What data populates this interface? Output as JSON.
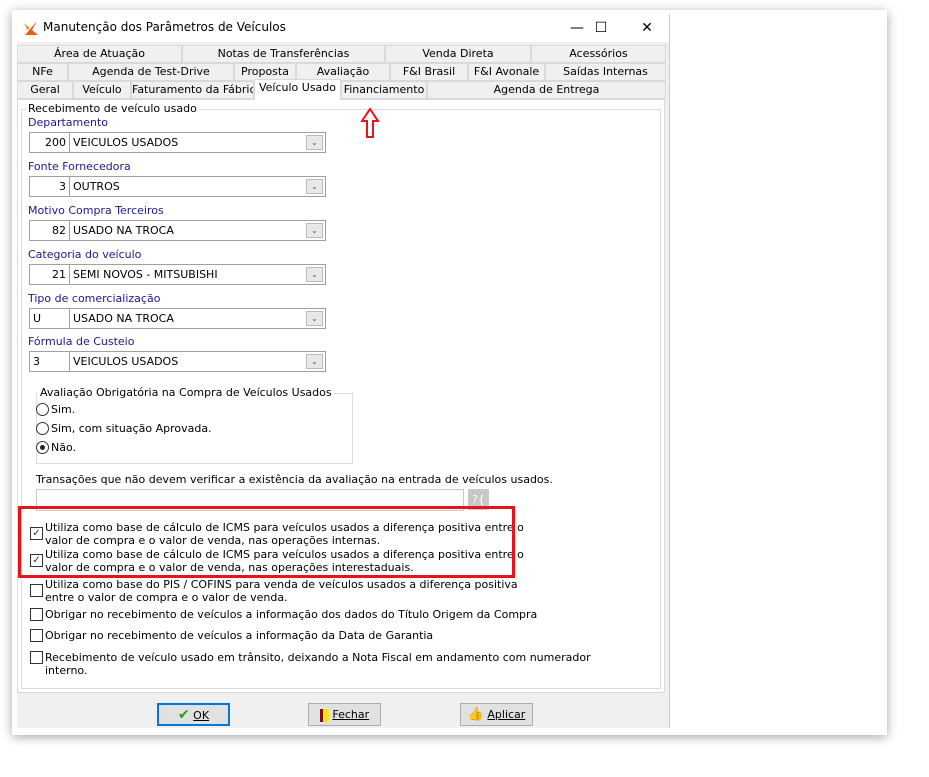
{
  "window": {
    "title": "Manutenção dos Parâmetros de Veículos",
    "minimize": "—",
    "maximize": "☐",
    "close": "✕"
  },
  "tabs": {
    "row1": [
      "Área de Atuação",
      "Notas de Transferências",
      "Venda Direta",
      "Acessórios"
    ],
    "row2": [
      "NFe",
      "Agenda de Test-Drive",
      "Proposta",
      "Avaliação",
      "F&I Brasil",
      "F&I Avonale",
      "Saídas Internas"
    ],
    "row3": [
      "Geral",
      "Veículo",
      "Faturamento da Fábrica",
      "Veículo Usado",
      "Financiamento",
      "Agenda de Entrega"
    ],
    "active": "Veículo Usado"
  },
  "group_title": "Recebimento de veículo usado",
  "fields": [
    {
      "label": "Departamento",
      "code": "200",
      "value": "VEICULOS USADOS"
    },
    {
      "label": "Fonte Fornecedora",
      "code": "3",
      "value": "OUTROS"
    },
    {
      "label": "Motivo Compra Terceiros",
      "code": "82",
      "value": "USADO NA TROCA"
    },
    {
      "label": "Categoria do veículo",
      "code": "21",
      "value": "SEMI NOVOS - MITSUBISHI"
    },
    {
      "label": "Tipo de comercialização",
      "code": "U",
      "value": "USADO NA TROCA"
    },
    {
      "label": "Fórmula de Custeio",
      "code": "3",
      "value": "VEICULOS USADOS"
    }
  ],
  "evaluation": {
    "title": "Avaliação Obrigatória na Compra de Veículos Usados",
    "options": [
      "Sim.",
      "Sim, com situação Aprovada.",
      "Não."
    ],
    "selected": "Não."
  },
  "transactions": {
    "label": "Transações que não devem verificar a existência da avaliação na entrada de veículos usados.",
    "value": "",
    "button": "?{"
  },
  "checkboxes": [
    {
      "label": "Utiliza como base de cálculo de ICMS para veículos usados a diferença positiva entre o valor de compra e o valor de venda, nas operações internas.",
      "checked": true
    },
    {
      "label": "Utiliza como base de cálculo de ICMS para veículos usados a diferença positiva entre o valor de compra e o valor de venda, nas operações interestaduais.",
      "checked": true
    },
    {
      "label": "Utiliza como base do PIS / COFINS  para venda de veículos usados a diferença positiva entre o valor de compra e o valor de venda.",
      "checked": false
    },
    {
      "label": "Obrigar no recebimento de veículos a informação dos dados do Título Origem da Compra",
      "checked": false
    },
    {
      "label": "Obrigar no recebimento de veículos a informação da Data de Garantia",
      "checked": false
    },
    {
      "label": "Recebimento de veículo usado em trânsito, deixando a Nota Fiscal em andamento com numerador interno.",
      "checked": false
    }
  ],
  "buttons": {
    "ok": "OK",
    "close": "Fechar",
    "apply": "Aplicar"
  },
  "colors": {
    "highlight": "#e8141c",
    "label": "#1a1a8c",
    "ok_border": "#0078d7"
  }
}
